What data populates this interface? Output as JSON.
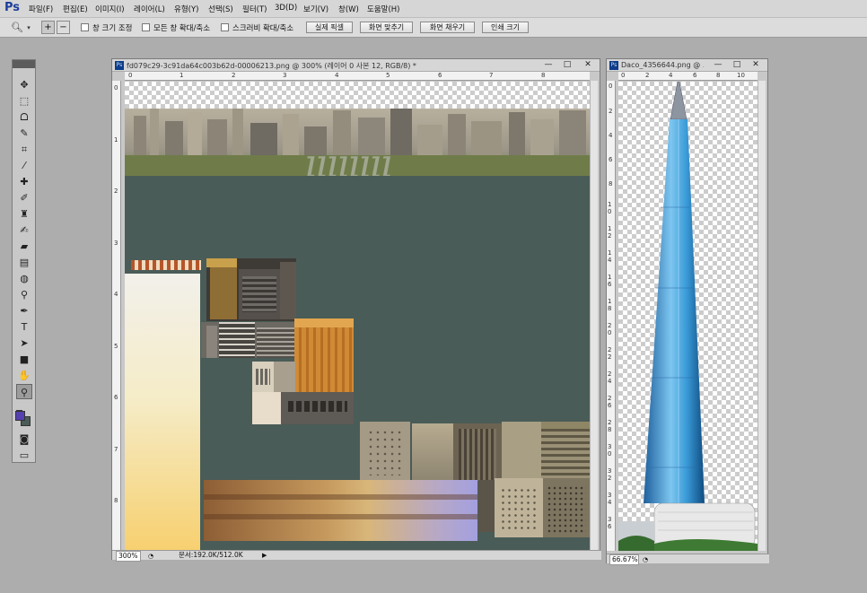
{
  "app": {
    "logo": "Ps",
    "accent_color": "#1c3e9c"
  },
  "menu": [
    "파일(F)",
    "편집(E)",
    "이미지(I)",
    "레이어(L)",
    "유형(Y)",
    "선택(S)",
    "필터(T)",
    "3D(D)",
    "보기(V)",
    "창(W)",
    "도움말(H)"
  ],
  "options_bar": {
    "zoom_tool_icon": "magnifier-icon",
    "zoom_in_icon": "zoom-in-icon",
    "zoom_out_icon": "zoom-out-icon",
    "checkboxes": [
      {
        "label": "창 크기 조정",
        "checked": false
      },
      {
        "label": "모든 창 확대/축소",
        "checked": false
      },
      {
        "label": "스크러비 확대/축소",
        "checked": false
      }
    ],
    "buttons": [
      "실제 픽셀",
      "화면 맞추기",
      "화면 채우기",
      "인쇄 크기"
    ]
  },
  "toolbox": {
    "tools": [
      "move-tool",
      "marquee-tool",
      "lasso-tool",
      "quick-selection-tool",
      "crop-tool",
      "eyedropper-tool",
      "spot-healing-tool",
      "brush-tool",
      "clone-stamp-tool",
      "history-brush-tool",
      "eraser-tool",
      "gradient-tool",
      "blur-tool",
      "dodge-tool",
      "pen-tool",
      "type-tool",
      "path-selection-tool",
      "rectangle-tool",
      "hand-tool",
      "zoom-tool"
    ],
    "active_tool": "zoom-tool",
    "foreground_color": "#5540b0",
    "background_color": "#4a5c57"
  },
  "doc1": {
    "title": "fd079c29-3c91da64c003b62d-00006213.png @ 300% (레이어 0 사본 12, RGB/8) *",
    "zoom": "300%",
    "doc_size": "문서:192.0K/512.0K",
    "ruler_h": [
      "0",
      "1",
      "2",
      "3",
      "4",
      "5",
      "6",
      "7",
      "8"
    ],
    "ruler_v": [
      "0",
      "1",
      "2",
      "3",
      "4",
      "5",
      "6",
      "7",
      "8"
    ],
    "canvas_bg": "#4a5c57"
  },
  "doc2": {
    "title": "Daco_4356644.png @ ...",
    "zoom": "66.67%",
    "ruler_h": [
      "0",
      "2",
      "4",
      "6",
      "8",
      "10"
    ],
    "ruler_v": [
      "0",
      "2",
      "4",
      "6",
      "8",
      "1 0",
      "1 2",
      "1 4",
      "1 6",
      "1 8",
      "2 0",
      "2 2",
      "2 4",
      "2 6",
      "2 8",
      "3 0",
      "3 2",
      "3 4",
      "3 6"
    ]
  },
  "window_controls": {
    "minimize": "—",
    "maximize": "□",
    "close": "✕"
  }
}
